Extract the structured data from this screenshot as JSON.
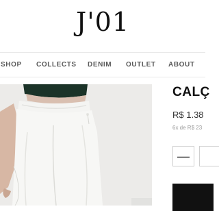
{
  "header": {
    "logo": "J'01"
  },
  "nav": {
    "items": [
      "SHOP",
      "COLLECTS",
      "DENIM",
      "OUTLET",
      "ABOUT"
    ]
  },
  "product": {
    "title": "CALÇ",
    "price": "R$ 1.38",
    "installments": "6x de R$ 23",
    "quantity": {
      "decrement_symbol": "—",
      "value": ""
    }
  },
  "icons": {
    "decrement": "minus-icon"
  }
}
